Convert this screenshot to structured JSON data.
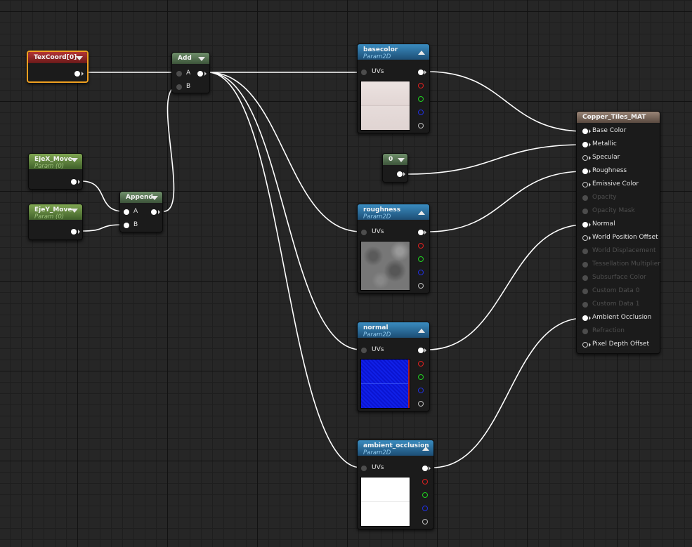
{
  "graph": {
    "texcoord": {
      "title": "TexCoord[0]"
    },
    "add": {
      "title": "Add",
      "pin_a": "A",
      "pin_b": "B"
    },
    "append": {
      "title": "Append",
      "pin_a": "A",
      "pin_b": "B"
    },
    "ejex": {
      "title": "EjeX_Move",
      "subtitle": "Param (0)"
    },
    "ejey": {
      "title": "EjeY_Move",
      "subtitle": "Param (0)"
    },
    "constant": {
      "title": "0"
    },
    "textures": [
      {
        "title": "basecolor",
        "subtitle": "Param2D",
        "input": "UVs"
      },
      {
        "title": "roughness",
        "subtitle": "Param2D",
        "input": "UVs"
      },
      {
        "title": "normal",
        "subtitle": "Param2D",
        "input": "UVs"
      },
      {
        "title": "ambient_occlusion",
        "subtitle": "Param2D",
        "input": "UVs"
      }
    ],
    "material": {
      "title": "Copper_Tiles_MAT",
      "inputs": [
        {
          "label": "Base Color",
          "state": "connected"
        },
        {
          "label": "Metallic",
          "state": "connected"
        },
        {
          "label": "Specular",
          "state": "open"
        },
        {
          "label": "Roughness",
          "state": "connected"
        },
        {
          "label": "Emissive Color",
          "state": "open"
        },
        {
          "label": "Opacity",
          "state": "disabled"
        },
        {
          "label": "Opacity Mask",
          "state": "disabled"
        },
        {
          "label": "Normal",
          "state": "connected"
        },
        {
          "label": "World Position Offset",
          "state": "open"
        },
        {
          "label": "World Displacement",
          "state": "disabled"
        },
        {
          "label": "Tessellation Multiplier",
          "state": "disabled"
        },
        {
          "label": "Subsurface Color",
          "state": "disabled"
        },
        {
          "label": "Custom Data 0",
          "state": "disabled"
        },
        {
          "label": "Custom Data 1",
          "state": "disabled"
        },
        {
          "label": "Ambient Occlusion",
          "state": "connected"
        },
        {
          "label": "Refraction",
          "state": "disabled"
        },
        {
          "label": "Pixel Depth Offset",
          "state": "open"
        }
      ]
    }
  },
  "colors": {
    "wire": "#ffffff",
    "selection": "#f0a020",
    "channel_r": "#e02020",
    "channel_g": "#20d020",
    "channel_b": "#2030e0"
  }
}
